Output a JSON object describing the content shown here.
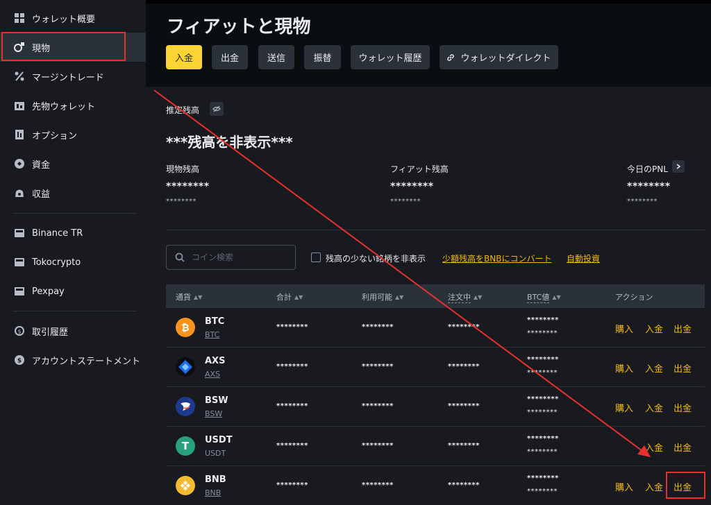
{
  "sidebar": {
    "items": [
      {
        "label": "ウォレット概要",
        "icon": "grid-icon",
        "active": false
      },
      {
        "label": "現物",
        "icon": "spot-icon",
        "active": true
      },
      {
        "label": "マージントレード",
        "icon": "percent-icon",
        "active": false
      },
      {
        "label": "先物ウォレット",
        "icon": "futures-icon",
        "active": false
      },
      {
        "label": "オプション",
        "icon": "options-icon",
        "active": false
      },
      {
        "label": "資金",
        "icon": "funding-icon",
        "active": false
      },
      {
        "label": "収益",
        "icon": "earn-icon",
        "active": false
      },
      {
        "label": "Binance TR",
        "icon": "wallet-icon",
        "active": false
      },
      {
        "label": "Tokocrypto",
        "icon": "wallet-icon",
        "active": false
      },
      {
        "label": "Pexpay",
        "icon": "wallet-icon",
        "active": false
      },
      {
        "label": "取引履歴",
        "icon": "history-icon",
        "active": false
      },
      {
        "label": "アカウントステートメント",
        "icon": "statement-icon",
        "active": false
      }
    ]
  },
  "header": {
    "title": "フィアットと現物",
    "buttons": {
      "deposit": "入金",
      "withdraw": "出金",
      "send": "送信",
      "transfer": "振替",
      "history": "ウォレット履歴",
      "direct": "ウォレットダイレクト"
    }
  },
  "balance": {
    "estimated_label": "推定残高",
    "hidden_text": "***残高を非表示***",
    "spot_label": "現物残高",
    "fiat_label": "フィアット残高",
    "pnl_label": "今日のPNL",
    "masked_big": "********",
    "masked_small": "********"
  },
  "filters": {
    "search_placeholder": "コイン検索",
    "hide_small_label": "残高の少ない銘柄を非表示",
    "convert_link": "少額残高をBNBにコンバート",
    "auto_invest_link": "自動投資"
  },
  "table": {
    "headers": {
      "currency": "通貨",
      "total": "合計",
      "available": "利用可能",
      "in_order": "注文中",
      "btc_value": "BTC値",
      "action": "アクション"
    },
    "rows": [
      {
        "symbol": "BTC",
        "name": "BTC",
        "total": "********",
        "available": "********",
        "in_order": "********",
        "btc1": "********",
        "btc2": "********",
        "color": "#f7931a"
      },
      {
        "symbol": "AXS",
        "name": "AXS",
        "total": "********",
        "available": "********",
        "in_order": "********",
        "btc1": "********",
        "btc2": "********",
        "color": "#0055d5"
      },
      {
        "symbol": "BSW",
        "name": "BSW",
        "total": "********",
        "available": "********",
        "in_order": "********",
        "btc1": "********",
        "btc2": "********",
        "color": "#f0554e"
      },
      {
        "symbol": "USDT",
        "name": "USDT",
        "total": "********",
        "available": "********",
        "in_order": "********",
        "btc1": "********",
        "btc2": "********",
        "color": "#26a17b"
      },
      {
        "symbol": "BNB",
        "name": "BNB",
        "total": "********",
        "available": "********",
        "in_order": "********",
        "btc1": "********",
        "btc2": "********",
        "color": "#f3ba2f"
      }
    ],
    "actions": {
      "buy": "購入",
      "deposit": "入金",
      "withdraw": "出金"
    }
  },
  "colors": {
    "accent": "#fcd535",
    "link": "#f0b90b",
    "annotation": "#e8312f"
  }
}
